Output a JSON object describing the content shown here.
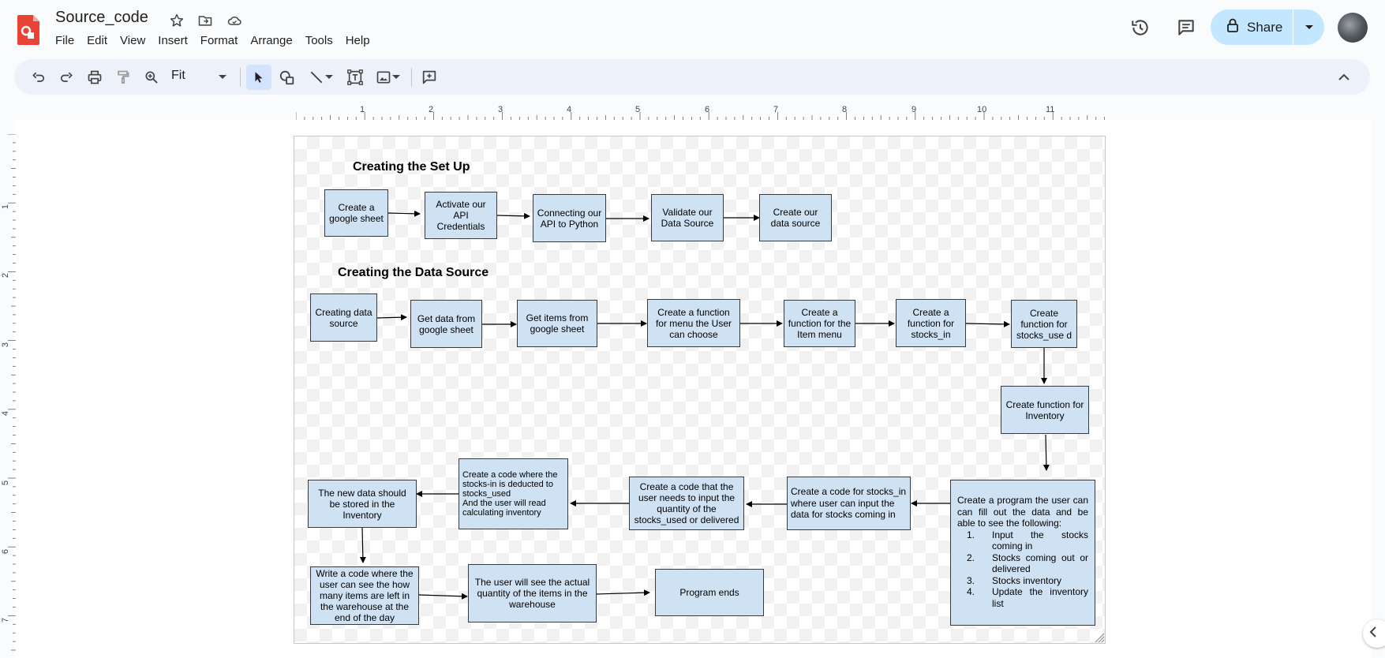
{
  "doc": {
    "title": "Source_code"
  },
  "menu": [
    "File",
    "Edit",
    "View",
    "Insert",
    "Format",
    "Arrange",
    "Tools",
    "Help"
  ],
  "share": {
    "label": "Share"
  },
  "toolbar": {
    "zoom": "Fit"
  },
  "ruler": {
    "horizontal": [
      "1",
      "2",
      "3",
      "4",
      "5",
      "6",
      "7",
      "8",
      "9",
      "10",
      "11"
    ],
    "vertical": [
      "1",
      "2",
      "3",
      "4",
      "5",
      "6",
      "7"
    ]
  },
  "diagram": {
    "section1_title": "Creating the Set Up",
    "section2_title": "Creating the Data Source",
    "setup": [
      "Create a google sheet",
      "Activate our API Credentials",
      "Connecting our API to Python",
      "Validate our Data Source",
      "Create our data source"
    ],
    "datasource": [
      "Creating data source",
      "Get data from google sheet",
      "Get items from google sheet",
      "Create a function for menu the User can choose",
      "Create a function for the Item menu",
      "Create a function for stocks_in",
      "Create function for stocks_use d"
    ],
    "inventory_box": "Create function for Inventory",
    "program_box": {
      "intro": "Create a program the user can can fill out the data and be able to see the following:",
      "items": [
        {
          "num": "1.",
          "text": "Input the stocks coming in"
        },
        {
          "num": "2.",
          "text": "Stocks coming out or delivered"
        },
        {
          "num": "3.",
          "text": "Stocks inventory"
        },
        {
          "num": "4.",
          "text": "Update the inventory list"
        }
      ]
    },
    "stocks_in_box": "Create a code for stocks_in where user can input the data for stocks coming in",
    "quantity_box": "Create a code that the user needs to input the quantity of the stocks_used or delivered",
    "deduct_box": "Create a code where the stocks-in is deducted to stocks_used\nAnd the user will read calculating inventory",
    "new_data_box": "The new data should be stored in the Inventory",
    "write_code_box": "Write a code where the user can see the how many items are left in the warehouse at the end of the day",
    "actual_qty_box": "The user will see the actual quantity of the items in the warehouse",
    "end_box": "Program ends"
  },
  "colors": {
    "box_fill": "#cfe2f3",
    "share_bg": "#c2e7ff",
    "toolbar_bg": "#edf2fa",
    "app_red": "#ea4335"
  }
}
